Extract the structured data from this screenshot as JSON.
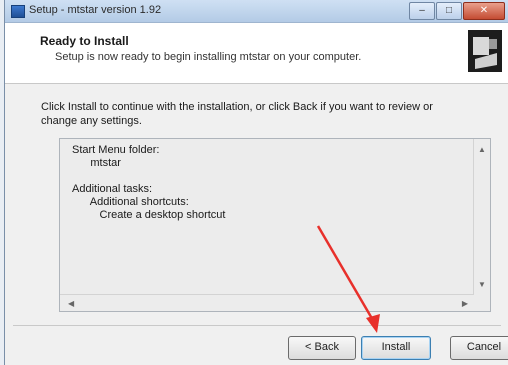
{
  "window": {
    "title": "Setup - mtstar version 1.92"
  },
  "titlebar_buttons": {
    "minimize": "–",
    "maximize": "□",
    "close": "✕"
  },
  "header": {
    "title": "Ready to Install",
    "subtitle": "Setup is now ready to begin installing mtstar on your computer."
  },
  "instructions": "Click Install to continue with the installation, or click Back if you want to review or change any settings.",
  "summary": {
    "start_menu_label": "Start Menu folder:",
    "start_menu_value": "mtstar",
    "tasks_label": "Additional tasks:",
    "shortcuts_label": "Additional shortcuts:",
    "shortcut_item": "Create a desktop shortcut"
  },
  "buttons": {
    "back": "< Back",
    "install": "Install",
    "cancel": "Cancel"
  },
  "colors": {
    "annotation_arrow": "#e8302b",
    "install_focus": "#3c7fb1"
  },
  "icons": [
    "setup-app-icon",
    "installer-computer-icon",
    "red-pointer-arrow"
  ]
}
